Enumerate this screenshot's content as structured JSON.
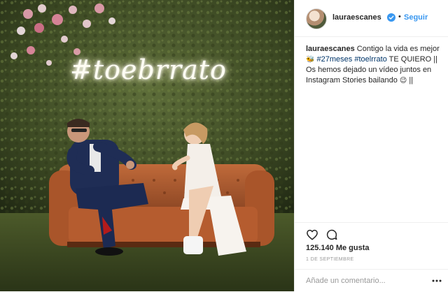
{
  "photo": {
    "neon_text": "#toebrrato",
    "alt": ""
  },
  "header": {
    "username": "lauraescanes",
    "separator": "•",
    "follow_label": "Seguir"
  },
  "caption": {
    "username": "lauraescanes",
    "text_1": " Contigo la vida es mejor ",
    "emoji_1": "🐝",
    "tag_1": "#27meses",
    "tag_2": "#toelrrato",
    "text_2": " TE QUIERO || Os hemos dejado un vídeo juntos en Instagram Stories bailando ",
    "emoji_2": "😉",
    "text_3": " ||"
  },
  "actions": {
    "like_icon": "heart-icon",
    "comment_icon": "comment-bubble-icon"
  },
  "likes": "125.140 Me gusta",
  "date": "1 DE SEPTIEMBRE",
  "comment_box": {
    "placeholder": "Añade un comentario...",
    "more_icon": "more-dots-icon"
  },
  "colors": {
    "link_blue": "#3897f0",
    "hashtag": "#003569",
    "border": "#efefef",
    "muted": "#999999"
  }
}
